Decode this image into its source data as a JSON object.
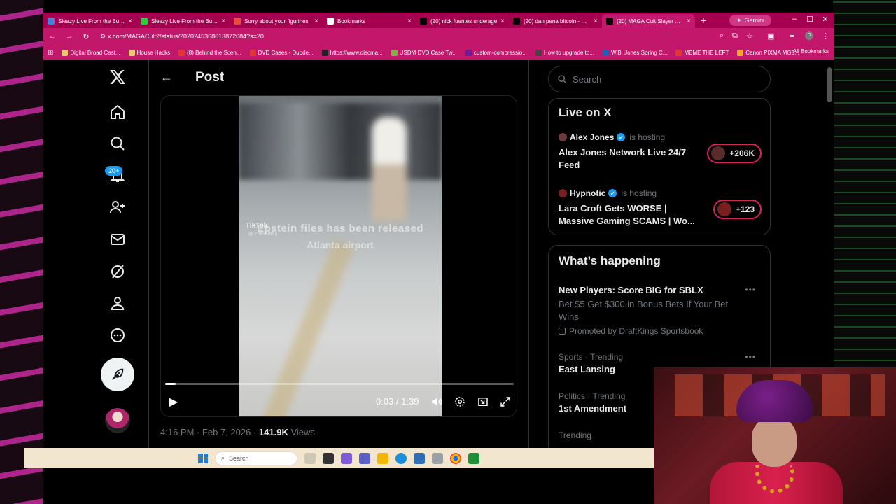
{
  "browser": {
    "tabs": [
      {
        "label": "Sleazy Live From the Bunker",
        "favicon_color": "#4f7bd9",
        "active": false
      },
      {
        "label": "Sleazy Live From the Bunker",
        "favicon_color": "#2ecc40",
        "active": false
      },
      {
        "label": "Sorry about your figurines",
        "favicon_color": "#e84b3c",
        "active": false
      },
      {
        "label": "Bookmarks",
        "favicon_color": "#ffffff",
        "active": false
      },
      {
        "label": "(20) nick fuentes underage",
        "favicon_color": "#000000",
        "active": false
      },
      {
        "label": "(20) dan pena bitcoin - Search",
        "favicon_color": "#000000",
        "active": false
      },
      {
        "label": "(20) MAGA Cult Slayer on X",
        "favicon_color": "#000000",
        "active": true
      }
    ],
    "gemini_label": "Gemini",
    "url": "x.com/MAGACult2/status/2020245368613872084?s=20",
    "bookmarks": [
      {
        "label": "Digital Broad Cast...",
        "color": "#f0c674"
      },
      {
        "label": "House Hacks",
        "color": "#f0c674"
      },
      {
        "label": "(8) Behind the Scen...",
        "color": "#e2372b"
      },
      {
        "label": "DVD Cases - Duode...",
        "color": "#e2372b"
      },
      {
        "label": "https://www.discma...",
        "color": "#222222"
      },
      {
        "label": "USDM DVD Case Tw...",
        "color": "#7cb342"
      },
      {
        "label": "custom-compressio...",
        "color": "#6a1b9a"
      },
      {
        "label": "How to upgrade to...",
        "color": "#444444"
      },
      {
        "label": "W.B. Jones Spring C...",
        "color": "#1565c0"
      },
      {
        "label": "MEME THE LEFT",
        "color": "#e2372b"
      },
      {
        "label": "Canon PIXMA MG3...",
        "color": "#f9a825"
      }
    ],
    "all_bookmarks": "All Bookmarks"
  },
  "x": {
    "notif_badge": "20+",
    "post": {
      "title": "Post",
      "video": {
        "tiktok_mark": "TikTok",
        "tiktok_user": "@ china.douj",
        "caption_line1": "Epstein files has been released",
        "caption_line2": "Atlanta airport",
        "time": "0:03 / 1:39",
        "progress": 0.03
      },
      "meta_time": "4:16 PM · Feb 7, 2026 · ",
      "views_count": "141.9K",
      "views_label": " Views"
    },
    "search_placeholder": "Search",
    "live": {
      "title": "Live on X",
      "items": [
        {
          "host": "Alex Jones",
          "hosting": "is hosting",
          "title": "Alex Jones Network Live 24/7 Feed",
          "count": "+206K"
        },
        {
          "host": "Hypnotic",
          "hosting": "is hosting",
          "title": "Lara Croft Gets WORSE | Massive Gaming SCAMS | Wo...",
          "count": "+123"
        }
      ]
    },
    "happening": {
      "title": "What’s happening",
      "promo": {
        "name": "New Players: Score BIG for SBLX",
        "desc": "Bet $5 Get $300 in Bonus Bets If Your Bet Wins",
        "by": "Promoted by DraftKings Sportsbook"
      },
      "trends": [
        {
          "meta": "Sports · Trending",
          "name": "East Lansing"
        },
        {
          "meta": "Politics · Trending",
          "name": "1st Amendment"
        },
        {
          "meta": "Trending",
          "name": ""
        }
      ]
    }
  },
  "taskbar": {
    "search_placeholder": "Search"
  },
  "colors": {
    "accent_pink": "#c2176b",
    "x_blue": "#1d9bf0",
    "live_ring": "#d81f63"
  }
}
